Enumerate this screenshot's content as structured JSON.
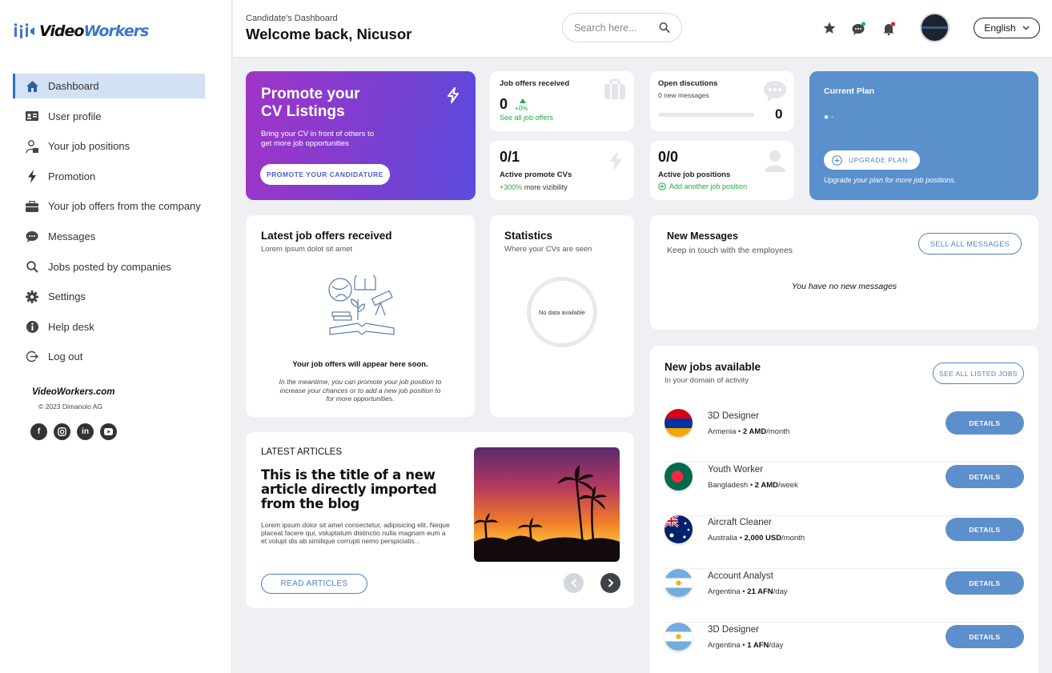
{
  "brand": {
    "name_left": "Video",
    "name_right": "Workers"
  },
  "sidebar": {
    "items": [
      {
        "label": "Dashboard",
        "icon": "home-icon"
      },
      {
        "label": "User profile",
        "icon": "id-card-icon"
      },
      {
        "label": "Your job positions",
        "icon": "user-tie-icon"
      },
      {
        "label": "Promotion",
        "icon": "bolt-icon"
      },
      {
        "label": "Your job offers from the company",
        "icon": "briefcase-icon"
      },
      {
        "label": "Messages",
        "icon": "chat-icon"
      },
      {
        "label": "Jobs posted by companies",
        "icon": "search-icon"
      },
      {
        "label": "Settings",
        "icon": "gear-icon"
      },
      {
        "label": "Help desk",
        "icon": "info-icon"
      },
      {
        "label": "Log out",
        "icon": "logout-icon"
      }
    ],
    "footer_brand": "VideoWorkers.com",
    "footer_copy": "© 2023 Dimanolo AG"
  },
  "header": {
    "subtitle": "Candidate's Dashboard",
    "title": "Welcome back, Nicusor",
    "search_placeholder": "Search here...",
    "language": "English"
  },
  "promo": {
    "title_line1": "Promote your",
    "title_line2": "CV Listings",
    "desc_line1": "Bring your CV in front of others to",
    "desc_line2": "get more job opportunities",
    "button": "PROMOTE YOUR CANDIDATURE"
  },
  "job_offers": {
    "label": "Job offers received",
    "count": "0",
    "change": "+0%",
    "link": "See all job offers"
  },
  "discussions": {
    "label": "Open discutions",
    "sub": "0 new messages",
    "count": "0"
  },
  "promote_cvs": {
    "count": "0/1",
    "label": "Active promote CVs",
    "pct": "+300%",
    "note": "more vizibility"
  },
  "job_positions": {
    "count": "0/0",
    "label": "Active job positions",
    "link": "Add another job position"
  },
  "plan": {
    "title": "Current Plan",
    "value": "-",
    "button": "UPGRADE PLAN",
    "note": "Upgrade your plan for more job positions."
  },
  "latest_offers": {
    "title": "Latest job offers received",
    "sub": "Lorem ipsum dolot sit amet",
    "empty_title": "Your job offers will appear here soon.",
    "empty_text": "In the meantime, you can promote your job position to increase your chances or to add a new job position to for more opportunities."
  },
  "statistics": {
    "title": "Statistics",
    "sub": "Where your CVs are seen",
    "empty": "No data available"
  },
  "messages": {
    "title": "New Messages",
    "sub": "Keep in touch with the employees",
    "button": "SELL ALL MESSAGES",
    "empty": "You have no new messages"
  },
  "articles": {
    "label": "LATEST ARTICLES",
    "title": "This is the title of a new article directly imported from the blog",
    "body": "Lorem ipsum dolor sit amet consectetur, adipisicing elit. Neque placeat facere qui, voluptatum distinctio nulla magnam eum a et volupt dis ab similique corrupti nemo perspiciatis...",
    "button": "READ ARTICLES"
  },
  "new_jobs": {
    "title": "New jobs available",
    "sub": "In your domain of activity",
    "button": "SEE ALL LISTED JOBS",
    "details_label": "DETAILS",
    "items": [
      {
        "title": "3D Designer",
        "country": "Armenia",
        "salary": "2 AMD",
        "period": "/month"
      },
      {
        "title": "Youth Worker",
        "country": "Bangladesh",
        "salary": "2 AMD",
        "period": "/week"
      },
      {
        "title": "Aircraft Cleaner",
        "country": "Australia",
        "salary": "2,000 USD",
        "period": "/month"
      },
      {
        "title": "Account Analyst",
        "country": "Argentina",
        "salary": "21 AFN",
        "period": "/day"
      },
      {
        "title": "3D Designer",
        "country": "Argentina",
        "salary": "1 AFN",
        "period": "/day"
      }
    ]
  },
  "colors": {
    "accent": "#4c84c4",
    "promo_start": "#a034c8",
    "promo_end": "#5b4bdd",
    "plan_bg": "#5a90cc",
    "green": "#28a745"
  }
}
